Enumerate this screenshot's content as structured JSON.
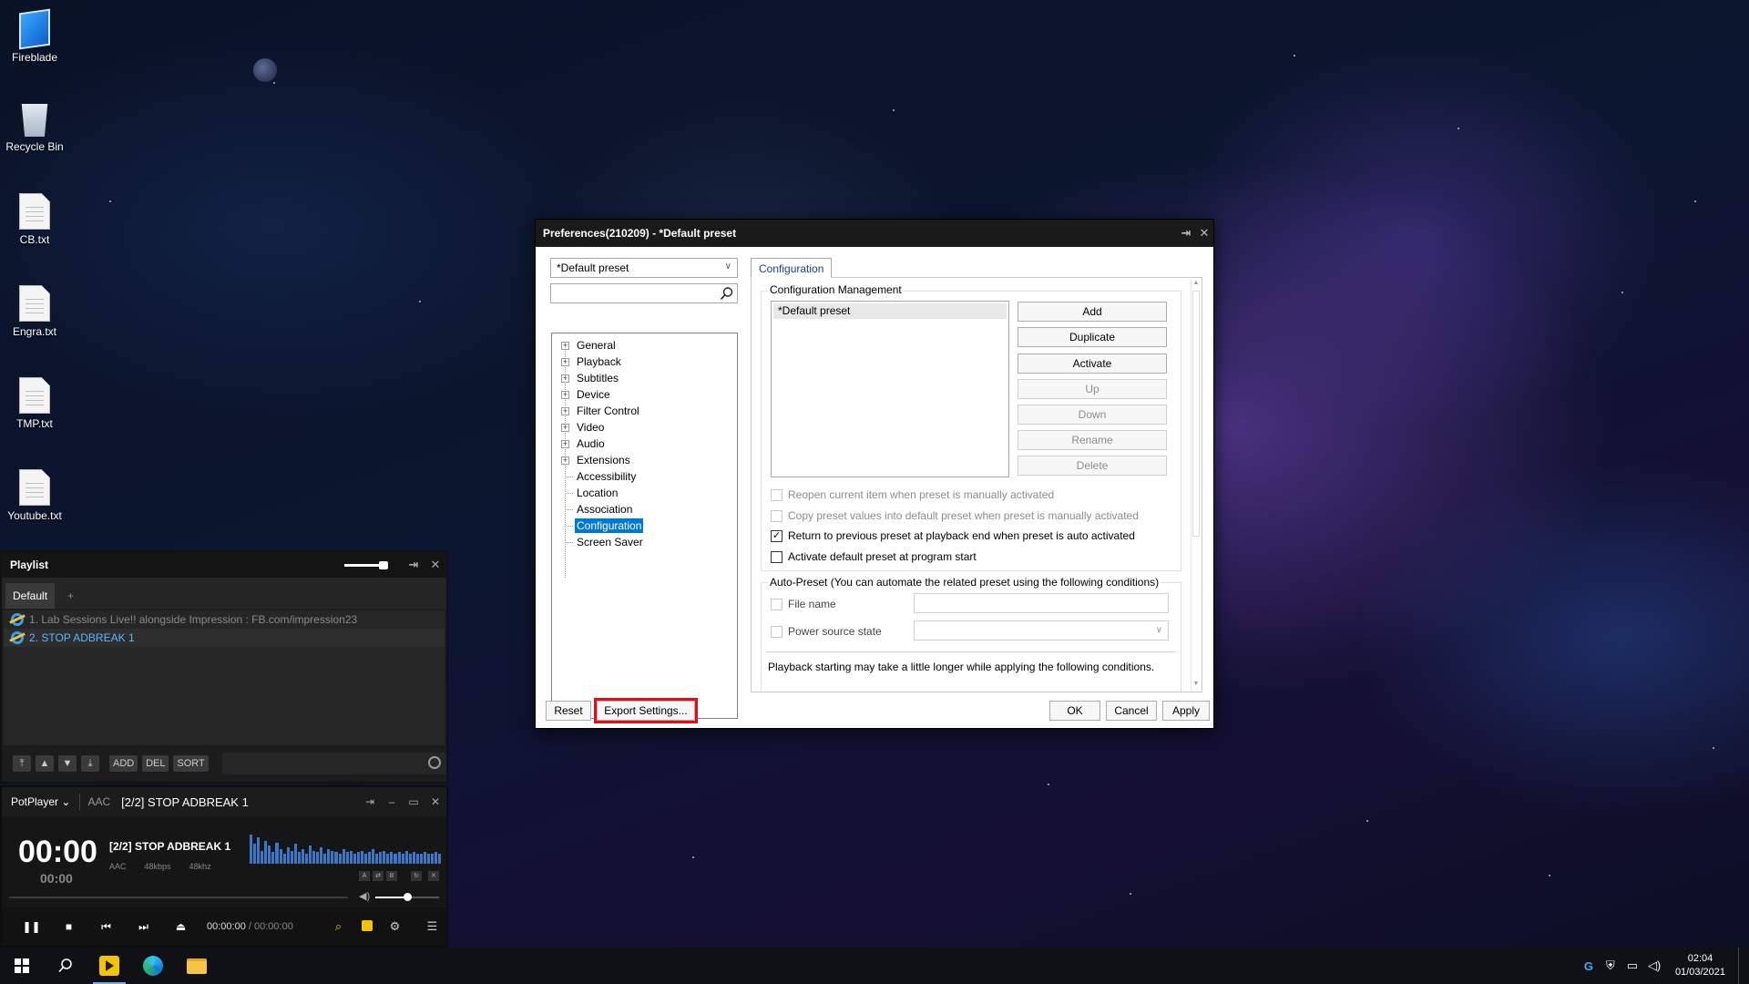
{
  "desktop": {
    "icons": [
      {
        "label": "Fireblade",
        "icon": "computer-icon"
      },
      {
        "label": "Recycle Bin",
        "icon": "recycle-bin-icon"
      },
      {
        "label": "CB.txt",
        "icon": "text-file-icon"
      },
      {
        "label": "Engra.txt",
        "icon": "text-file-icon"
      },
      {
        "label": "TMP.txt",
        "icon": "text-file-icon"
      },
      {
        "label": "Youtube.txt",
        "icon": "text-file-icon"
      }
    ]
  },
  "dialog": {
    "title": "Preferences(210209) - *Default preset",
    "pin_glyph": "⇥",
    "close_glyph": "✕",
    "preset_combo": "*Default preset",
    "search_placeholder": "",
    "tree": [
      {
        "label": "General",
        "expandable": true
      },
      {
        "label": "Playback",
        "expandable": true
      },
      {
        "label": "Subtitles",
        "expandable": true
      },
      {
        "label": "Device",
        "expandable": true
      },
      {
        "label": "Filter Control",
        "expandable": true
      },
      {
        "label": "Video",
        "expandable": true
      },
      {
        "label": "Audio",
        "expandable": true
      },
      {
        "label": "Extensions",
        "expandable": true
      },
      {
        "label": "Accessibility",
        "expandable": false
      },
      {
        "label": "Location",
        "expandable": false
      },
      {
        "label": "Association",
        "expandable": false
      },
      {
        "label": "Configuration",
        "expandable": false,
        "selected": true
      },
      {
        "label": "Screen Saver",
        "expandable": false
      }
    ],
    "tab": "Configuration",
    "config_mgmt": {
      "group_label": "Configuration Management",
      "preset_list": [
        "*Default preset"
      ],
      "buttons": {
        "add": "Add",
        "duplicate": "Duplicate",
        "activate": "Activate",
        "up": "Up",
        "down": "Down",
        "rename": "Rename",
        "delete": "Delete"
      },
      "options": [
        {
          "label": "Reopen current item when preset is manually activated",
          "checked": false,
          "enabled": false
        },
        {
          "label": "Copy preset values into default preset when preset is manually activated",
          "checked": false,
          "enabled": false
        },
        {
          "label": "Return to previous preset at playback end when preset is auto activated",
          "checked": true,
          "enabled": true
        },
        {
          "label": "Activate default preset at program start",
          "checked": false,
          "enabled": true
        }
      ]
    },
    "auto_preset": {
      "group_label": "Auto-Preset (You can automate the related preset using the following conditions)",
      "file_name_label": "File name",
      "power_source_label": "Power source state",
      "note": "Playback starting may take a little longer while applying the following conditions."
    },
    "footer": {
      "reset": "Reset",
      "export": "Export Settings...",
      "ok": "OK",
      "cancel": "Cancel",
      "apply": "Apply"
    },
    "highlight_color": "#e0101b"
  },
  "playlist": {
    "title": "Playlist",
    "tabs": [
      "Default"
    ],
    "add_tab": "+",
    "items": [
      {
        "label": "1. Lab Sessions Live!! alongside Impression : FB.com/impression23",
        "active": false
      },
      {
        "label": "2. STOP ADBREAK 1",
        "active": true
      }
    ],
    "buttons": {
      "top": "⤒",
      "up": "▲",
      "down": "▼",
      "bottom": "⤓",
      "add": "ADD",
      "del": "DEL",
      "sort": "SORT"
    },
    "volume_level": 0.8
  },
  "player": {
    "app_name": "PotPlayer",
    "app_menu_glyph": "⌄",
    "format": "AAC",
    "title_file": "[2/2] STOP ADBREAK 1",
    "time_main": "00:00",
    "time_sub": "00:00",
    "track": "[2/2] STOP ADBREAK 1",
    "meta": [
      "AAC",
      "48kbps",
      "48khz"
    ],
    "elapsed": "00:00:00",
    "separator": "/",
    "total": "00:00:00",
    "volume_level": 0.5,
    "accent": "#f5c400"
  },
  "taskbar": {
    "time": "02:04",
    "date": "01/03/2021"
  }
}
